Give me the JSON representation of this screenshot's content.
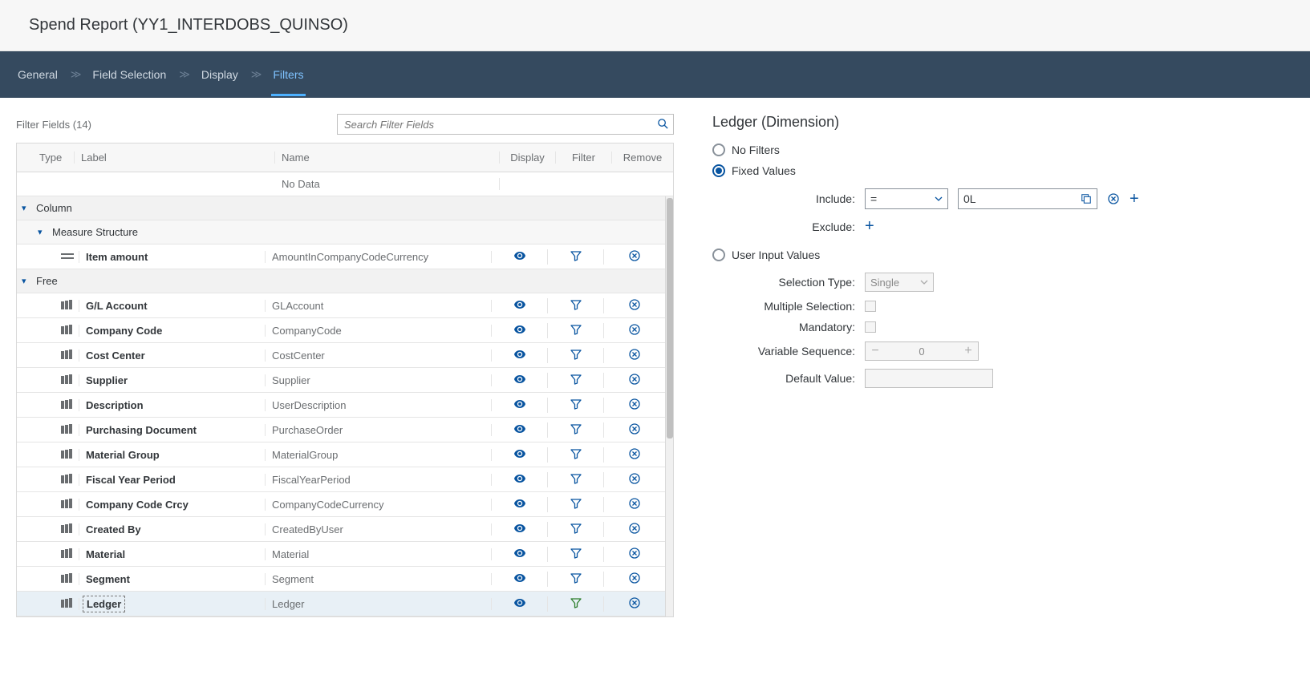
{
  "page_title": "Spend Report (YY1_INTERDOBS_QUINSO)",
  "wizard": {
    "steps": [
      "General",
      "Field Selection",
      "Display",
      "Filters"
    ],
    "active_index": 3
  },
  "filter_fields_label": "Filter Fields (14)",
  "search_placeholder": "Search Filter Fields",
  "columns": {
    "type": "Type",
    "label": "Label",
    "name": "Name",
    "display": "Display",
    "filter": "Filter",
    "remove": "Remove"
  },
  "no_data": "No Data",
  "groups": {
    "column": "Column",
    "measure_structure": "Measure Structure",
    "free": "Free"
  },
  "measure_row": {
    "label": "Item amount",
    "name": "AmountInCompanyCodeCurrency"
  },
  "rows": [
    {
      "label": "G/L Account",
      "name": "GLAccount",
      "selected": false
    },
    {
      "label": "Company Code",
      "name": "CompanyCode",
      "selected": false
    },
    {
      "label": "Cost Center",
      "name": "CostCenter",
      "selected": false
    },
    {
      "label": "Supplier",
      "name": "Supplier",
      "selected": false
    },
    {
      "label": "Description",
      "name": "UserDescription",
      "selected": false
    },
    {
      "label": "Purchasing Document",
      "name": "PurchaseOrder",
      "selected": false
    },
    {
      "label": "Material Group",
      "name": "MaterialGroup",
      "selected": false
    },
    {
      "label": "Fiscal Year Period",
      "name": "FiscalYearPeriod",
      "selected": false
    },
    {
      "label": "Company Code Crcy",
      "name": "CompanyCodeCurrency",
      "selected": false
    },
    {
      "label": "Created By",
      "name": "CreatedByUser",
      "selected": false
    },
    {
      "label": "Material",
      "name": "Material",
      "selected": false
    },
    {
      "label": "Segment",
      "name": "Segment",
      "selected": false
    },
    {
      "label": "Ledger",
      "name": "Ledger",
      "selected": true
    }
  ],
  "right": {
    "title": "Ledger (Dimension)",
    "radio_no_filters": "No Filters",
    "radio_fixed_values": "Fixed Values",
    "radio_user_input": "User Input Values",
    "include_label": "Include:",
    "exclude_label": "Exclude:",
    "operator": "=",
    "value": "0L",
    "selection_type_label": "Selection Type:",
    "selection_type_value": "Single",
    "multiple_selection_label": "Multiple Selection:",
    "mandatory_label": "Mandatory:",
    "variable_sequence_label": "Variable Sequence:",
    "variable_sequence_value": "0",
    "default_value_label": "Default Value:"
  }
}
